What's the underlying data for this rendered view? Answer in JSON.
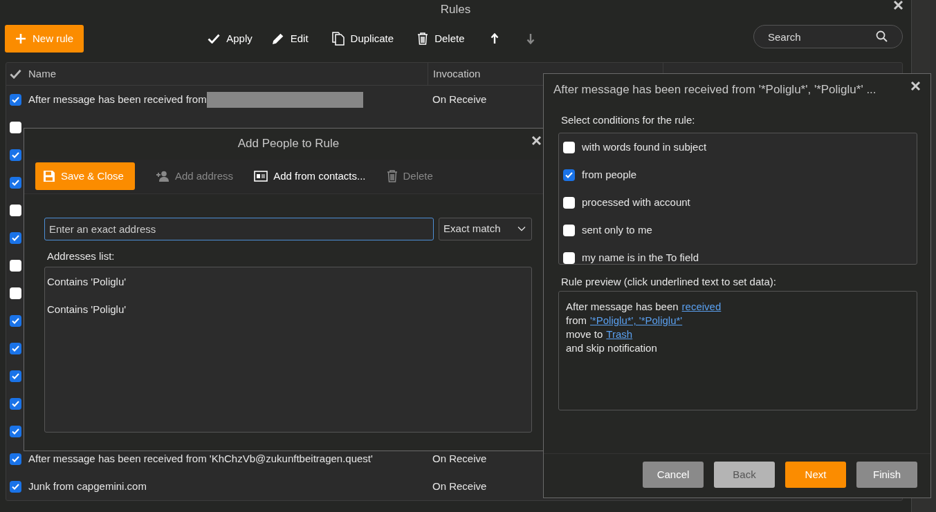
{
  "window": {
    "title": "Rules"
  },
  "toolbar": {
    "new_rule": "New rule",
    "actions": [
      {
        "label": "Apply",
        "disabled": false
      },
      {
        "label": "Edit",
        "disabled": false
      },
      {
        "label": "Duplicate",
        "disabled": false
      },
      {
        "label": "Delete",
        "disabled": false
      },
      {
        "disabled": false
      },
      {
        "disabled": true
      }
    ]
  },
  "search": {
    "placeholder": "Search"
  },
  "table": {
    "columns": [
      "Name",
      "Invocation"
    ],
    "rows": [
      {
        "checked": true,
        "name": "After message has been received from",
        "redacted": true,
        "invocation": "On Receive"
      },
      {
        "checked": false
      },
      {
        "checked": true
      },
      {
        "checked": true
      },
      {
        "checked": false
      },
      {
        "checked": true
      },
      {
        "checked": false
      },
      {
        "checked": false
      },
      {
        "checked": true
      },
      {
        "checked": true
      },
      {
        "checked": true
      },
      {
        "checked": true
      },
      {
        "checked": true
      },
      {
        "checked": true,
        "name": "After message has been received from 'KhChzVb@zukunftbeitragen.quest'",
        "invocation": "On Receive"
      },
      {
        "checked": true,
        "name": "Junk from capgemini.com",
        "invocation": "On Receive"
      }
    ]
  },
  "add_people_dialog": {
    "title": "Add People to Rule",
    "buttons": [
      {
        "label": "Save & Close",
        "kind": "primary",
        "disabled": false
      },
      {
        "label": "Add address",
        "kind": "plain",
        "disabled": true
      },
      {
        "label": "Add from contacts...",
        "kind": "plain",
        "disabled": false
      },
      {
        "label": "Delete",
        "kind": "plain",
        "disabled": true
      }
    ],
    "address_field": {
      "placeholder": "Enter an exact address"
    },
    "match_select": {
      "value": "Exact match"
    },
    "list_label": "Addresses list:",
    "addresses": [
      "Contains 'Poliglu'",
      "Contains 'Poliglu'"
    ]
  },
  "rule_wizard": {
    "title": "After message has been received from '*Poliglu*', '*Poliglu*' ...",
    "conditions_label": "Select conditions for the rule:",
    "conditions": [
      {
        "label": "with words found in subject",
        "checked": false
      },
      {
        "label": "from people",
        "checked": true
      },
      {
        "label": "processed with account",
        "checked": false
      },
      {
        "label": "sent only to me",
        "checked": false
      },
      {
        "label": "my name is in the To field",
        "checked": false
      }
    ],
    "preview_label": "Rule preview (click underlined text to set data):",
    "preview": [
      [
        {
          "kind": "text",
          "text": "After message has been"
        },
        {
          "kind": "link",
          "text": "received"
        }
      ],
      [
        {
          "kind": "text",
          "text": "from"
        },
        {
          "kind": "link",
          "text": "'*Poliglu*', '*Poliglu*'"
        }
      ],
      [
        {
          "kind": "text",
          "text": "move to"
        },
        {
          "kind": "link",
          "text": "Trash"
        }
      ],
      [
        {
          "kind": "text",
          "text": "and skip notification"
        }
      ]
    ],
    "buttons": [
      {
        "label": "Cancel",
        "kind": "secondary"
      },
      {
        "label": "Back",
        "kind": "light"
      },
      {
        "label": "Next",
        "kind": "primary"
      },
      {
        "label": "Finish",
        "kind": "secondary"
      }
    ]
  }
}
